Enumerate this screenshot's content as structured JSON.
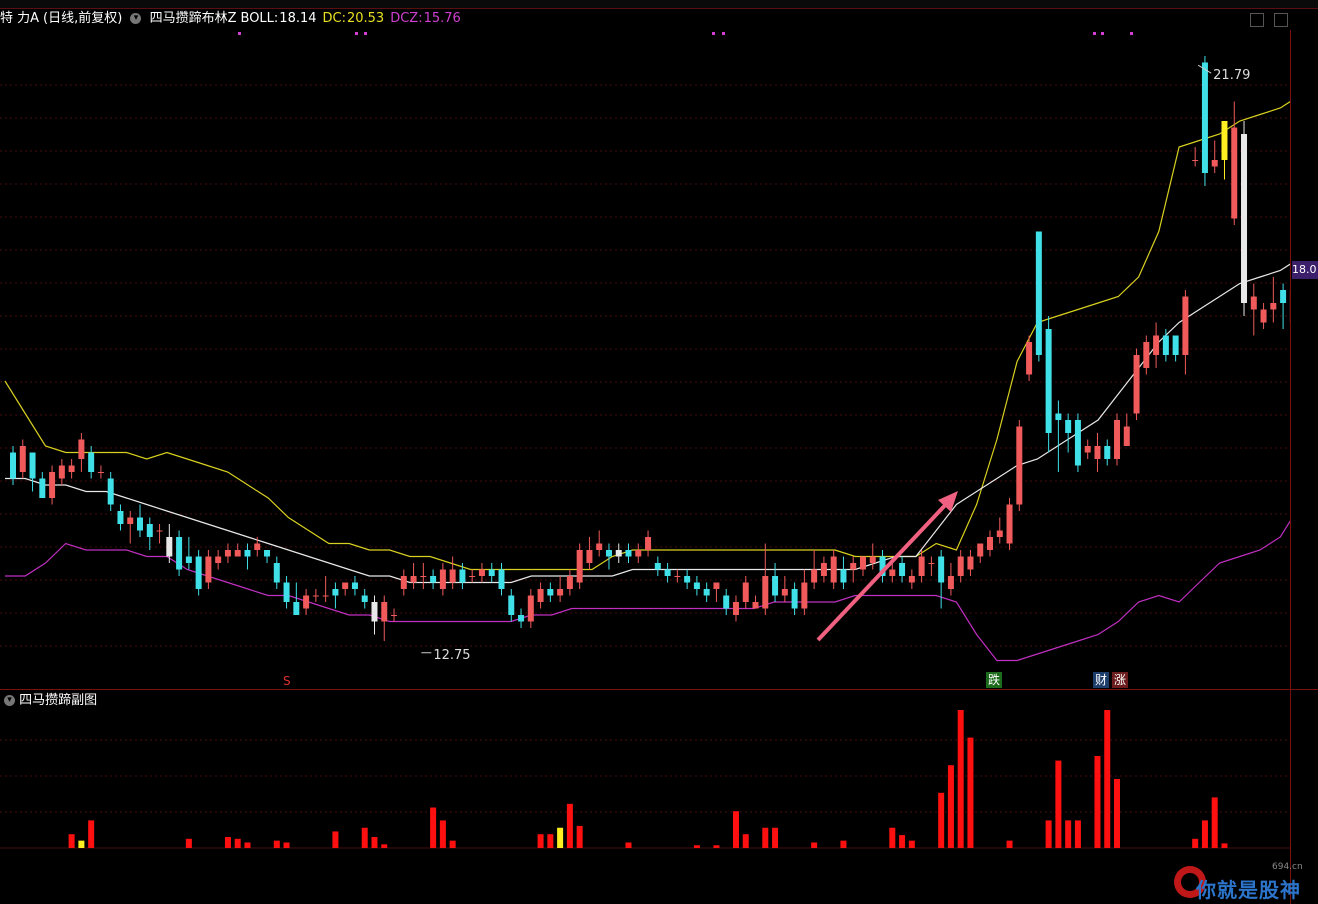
{
  "header": {
    "stock_name": "特 力A",
    "period": "(日线,前复权)",
    "indicator_name": "四马攒蹄布林Z",
    "boll_label": "BOLL:",
    "boll_value": "18.14",
    "dc_label": "DC:",
    "dc_value": "20.53",
    "dcz_label": "DCZ:",
    "dcz_value": "15.76"
  },
  "current_price_tag": "18.0",
  "subchart": {
    "title": "四马攒蹄副图"
  },
  "tags": {
    "s_marker": "S",
    "die": "跌",
    "cai": "财",
    "zhang": "涨"
  },
  "watermark": {
    "site": "694.cn",
    "text": "你就是股神"
  },
  "colors": {
    "up": "#f05a5a",
    "down": "#3fe0e8",
    "mid": "#e8e8e8",
    "upper": "#d8d020",
    "lower": "#c030c0",
    "bar": "#ff1010",
    "hl": "#ffee22",
    "arrow": "#f06080"
  },
  "chart_data": {
    "type": "candlestick",
    "price_range": [
      12.3,
      22.3
    ],
    "annotations": [
      {
        "text": "21.79",
        "kind": "high"
      },
      {
        "text": "12.75",
        "kind": "low"
      }
    ],
    "candles": [
      [
        15.8,
        15.4,
        15.9,
        15.3
      ],
      [
        15.5,
        15.9,
        16.0,
        15.4
      ],
      [
        15.8,
        15.4,
        15.8,
        15.2
      ],
      [
        15.4,
        15.1,
        15.5,
        15.1
      ],
      [
        15.1,
        15.5,
        15.6,
        15.0
      ],
      [
        15.4,
        15.6,
        15.7,
        15.3
      ],
      [
        15.5,
        15.6,
        15.7,
        15.4
      ],
      [
        15.7,
        16.0,
        16.1,
        15.5
      ],
      [
        15.8,
        15.5,
        15.9,
        15.4
      ],
      [
        15.5,
        15.5,
        15.6,
        15.4
      ],
      [
        15.4,
        15.0,
        15.5,
        14.9
      ],
      [
        14.9,
        14.7,
        15.0,
        14.6
      ],
      [
        14.7,
        14.8,
        14.9,
        14.4
      ],
      [
        14.8,
        14.6,
        15.0,
        14.5
      ],
      [
        14.7,
        14.5,
        14.8,
        14.3
      ],
      [
        14.6,
        14.6,
        14.7,
        14.4
      ],
      [
        14.5,
        14.2,
        14.7,
        14.1
      ],
      [
        14.5,
        14.0,
        14.6,
        13.9
      ],
      [
        14.2,
        14.1,
        14.5,
        14.0
      ],
      [
        14.2,
        13.7,
        14.3,
        13.6
      ],
      [
        13.8,
        14.2,
        14.3,
        13.7
      ],
      [
        14.1,
        14.2,
        14.3,
        14.0
      ],
      [
        14.2,
        14.3,
        14.4,
        14.1
      ],
      [
        14.2,
        14.3,
        14.4,
        14.2
      ],
      [
        14.3,
        14.2,
        14.4,
        14.0
      ],
      [
        14.3,
        14.4,
        14.5,
        14.2
      ],
      [
        14.3,
        14.2,
        14.3,
        14.1
      ],
      [
        14.1,
        13.8,
        14.2,
        13.7
      ],
      [
        13.8,
        13.5,
        13.9,
        13.4
      ],
      [
        13.5,
        13.3,
        13.8,
        13.3
      ],
      [
        13.4,
        13.6,
        13.7,
        13.3
      ],
      [
        13.6,
        13.6,
        13.7,
        13.5
      ],
      [
        13.6,
        13.6,
        13.9,
        13.5
      ],
      [
        13.7,
        13.6,
        13.8,
        13.4
      ],
      [
        13.7,
        13.8,
        13.8,
        13.6
      ],
      [
        13.8,
        13.7,
        13.9,
        13.6
      ],
      [
        13.6,
        13.5,
        13.7,
        13.4
      ],
      [
        13.5,
        13.2,
        13.6,
        13.0
      ],
      [
        13.2,
        13.5,
        13.6,
        12.9
      ],
      [
        13.3,
        13.3,
        13.4,
        13.2
      ],
      [
        13.7,
        13.9,
        14.0,
        13.6
      ],
      [
        13.8,
        13.9,
        14.1,
        13.7
      ],
      [
        13.9,
        13.9,
        14.1,
        13.7
      ],
      [
        13.9,
        13.8,
        14.0,
        13.7
      ],
      [
        13.7,
        14.0,
        14.1,
        13.6
      ],
      [
        13.8,
        14.0,
        14.2,
        13.7
      ],
      [
        14.0,
        13.8,
        14.1,
        13.7
      ],
      [
        13.9,
        13.9,
        14.0,
        13.8
      ],
      [
        13.9,
        14.0,
        14.1,
        13.8
      ],
      [
        14.0,
        13.9,
        14.1,
        13.8
      ],
      [
        14.0,
        13.7,
        14.1,
        13.6
      ],
      [
        13.6,
        13.3,
        13.7,
        13.2
      ],
      [
        13.3,
        13.2,
        13.4,
        13.1
      ],
      [
        13.2,
        13.6,
        13.7,
        13.1
      ],
      [
        13.5,
        13.7,
        13.8,
        13.4
      ],
      [
        13.7,
        13.6,
        13.8,
        13.5
      ],
      [
        13.6,
        13.7,
        13.9,
        13.5
      ],
      [
        13.7,
        13.9,
        14.0,
        13.6
      ],
      [
        13.8,
        14.3,
        14.4,
        13.7
      ],
      [
        14.1,
        14.3,
        14.5,
        14.0
      ],
      [
        14.3,
        14.4,
        14.6,
        14.2
      ],
      [
        14.3,
        14.2,
        14.4,
        14.0
      ],
      [
        14.2,
        14.3,
        14.4,
        14.1
      ],
      [
        14.3,
        14.2,
        14.4,
        14.1
      ],
      [
        14.2,
        14.3,
        14.4,
        14.1
      ],
      [
        14.3,
        14.5,
        14.6,
        14.2
      ],
      [
        14.1,
        14.0,
        14.2,
        13.9
      ],
      [
        14.0,
        13.9,
        14.1,
        13.8
      ],
      [
        13.9,
        13.9,
        14.0,
        13.8
      ],
      [
        13.9,
        13.8,
        14.0,
        13.7
      ],
      [
        13.8,
        13.7,
        13.9,
        13.6
      ],
      [
        13.7,
        13.6,
        13.8,
        13.5
      ],
      [
        13.7,
        13.8,
        13.8,
        13.5
      ],
      [
        13.6,
        13.4,
        13.7,
        13.3
      ],
      [
        13.3,
        13.5,
        13.6,
        13.2
      ],
      [
        13.5,
        13.8,
        13.9,
        13.4
      ],
      [
        13.4,
        13.5,
        13.6,
        13.4
      ],
      [
        13.4,
        13.9,
        14.4,
        13.3
      ],
      [
        13.9,
        13.6,
        14.1,
        13.5
      ],
      [
        13.6,
        13.7,
        13.9,
        13.5
      ],
      [
        13.7,
        13.4,
        13.8,
        13.3
      ],
      [
        13.4,
        13.8,
        14.0,
        13.3
      ],
      [
        13.8,
        14.0,
        14.3,
        13.7
      ],
      [
        13.9,
        14.1,
        14.2,
        13.8
      ],
      [
        13.8,
        14.2,
        14.3,
        13.7
      ],
      [
        14.0,
        13.8,
        14.2,
        13.7
      ],
      [
        14.0,
        14.1,
        14.2,
        13.8
      ],
      [
        14.0,
        14.2,
        14.2,
        13.9
      ],
      [
        14.1,
        14.2,
        14.4,
        14.0
      ],
      [
        14.2,
        13.9,
        14.3,
        13.8
      ],
      [
        13.9,
        14.0,
        14.1,
        13.8
      ],
      [
        14.1,
        13.9,
        14.2,
        13.8
      ],
      [
        13.8,
        13.9,
        14.0,
        13.7
      ],
      [
        13.9,
        14.2,
        14.3,
        13.8
      ],
      [
        14.1,
        14.1,
        14.2,
        13.9
      ],
      [
        14.2,
        13.8,
        14.3,
        13.4
      ],
      [
        13.7,
        13.9,
        14.1,
        13.6
      ],
      [
        13.9,
        14.2,
        14.3,
        13.8
      ],
      [
        14.0,
        14.2,
        14.3,
        13.9
      ],
      [
        14.2,
        14.4,
        14.4,
        14.1
      ],
      [
        14.3,
        14.5,
        14.6,
        14.2
      ],
      [
        14.5,
        14.6,
        14.8,
        14.4
      ],
      [
        14.4,
        15.0,
        15.1,
        14.3
      ],
      [
        15.0,
        16.2,
        16.3,
        14.9
      ],
      [
        17.0,
        17.5,
        17.6,
        16.9
      ],
      [
        19.2,
        17.3,
        19.2,
        17.2
      ],
      [
        17.7,
        16.1,
        17.9,
        15.8
      ],
      [
        16.4,
        16.3,
        16.6,
        15.5
      ],
      [
        16.3,
        16.1,
        16.4,
        15.8
      ],
      [
        16.3,
        15.6,
        16.4,
        15.5
      ],
      [
        15.8,
        15.9,
        16.0,
        15.7
      ],
      [
        15.7,
        15.9,
        16.1,
        15.5
      ],
      [
        15.9,
        15.7,
        16.0,
        15.6
      ],
      [
        15.7,
        16.3,
        16.4,
        15.6
      ],
      [
        15.9,
        16.2,
        16.4,
        15.9
      ],
      [
        16.4,
        17.3,
        17.4,
        16.3
      ],
      [
        17.1,
        17.5,
        17.6,
        17.0
      ],
      [
        17.3,
        17.6,
        17.8,
        17.1
      ],
      [
        17.6,
        17.3,
        17.7,
        17.2
      ],
      [
        17.6,
        17.3,
        17.6,
        17.2
      ],
      [
        17.3,
        18.2,
        18.3,
        17.0
      ],
      [
        20.3,
        20.3,
        20.5,
        20.2
      ],
      [
        21.8,
        20.1,
        21.9,
        19.9
      ],
      [
        20.2,
        20.3,
        20.6,
        20.1
      ],
      [
        20.3,
        20.9,
        20.9,
        20.0
      ],
      [
        19.4,
        20.8,
        21.2,
        19.3
      ],
      [
        20.7,
        18.1,
        20.9,
        17.9
      ],
      [
        18.0,
        18.2,
        18.4,
        17.6
      ],
      [
        17.8,
        18.0,
        18.1,
        17.7
      ],
      [
        18.0,
        18.1,
        18.5,
        17.8
      ],
      [
        18.3,
        18.1,
        18.4,
        17.7
      ],
      [
        17.8,
        18.3,
        18.8,
        17.7
      ],
      [
        18.5,
        18.2,
        18.6,
        18.0
      ],
      [
        18.0,
        18.5,
        18.6,
        17.9
      ],
      [
        19.0,
        19.3,
        19.6,
        18.6
      ],
      [
        19.3,
        19.0,
        19.6,
        18.9
      ],
      [
        19.2,
        18.5,
        19.5,
        18.4
      ],
      [
        18.8,
        18.0,
        18.9,
        17.9
      ],
      [
        18.2,
        17.3,
        18.2,
        17.3
      ]
    ],
    "candle_colors": {
      "16": "#e8e8e8",
      "37": "#e8e8e8",
      "62": "#e8e8e8",
      "126": "#e8e8e8",
      "124": "#ffee22"
    },
    "series": [
      {
        "line": "upper",
        "values": [
          16.9,
          16.4,
          15.9,
          15.8,
          15.8,
          15.8,
          15.8,
          15.7,
          15.8,
          15.7,
          15.6,
          15.5,
          15.3,
          15.1,
          14.8,
          14.6,
          14.4,
          14.4,
          14.3,
          14.3,
          14.2,
          14.2,
          14.1,
          14.0,
          14.0,
          14.0,
          14.0,
          14.0,
          14.0,
          14.0,
          14.2,
          14.3,
          14.3,
          14.3,
          14.3,
          14.3,
          14.3,
          14.3,
          14.3,
          14.3,
          14.3,
          14.3,
          14.2,
          14.2,
          14.2,
          14.2,
          14.4,
          14.3,
          15.0,
          16.0,
          17.2,
          17.8,
          17.9,
          18.0,
          18.1,
          18.2,
          18.5,
          19.2,
          20.5,
          20.6,
          20.7,
          20.9,
          21.0,
          21.1,
          21.3,
          21.4,
          21.3,
          21.1
        ]
      },
      {
        "line": "mid",
        "values": [
          15.4,
          15.4,
          15.3,
          15.3,
          15.2,
          15.2,
          15.1,
          15.0,
          14.9,
          14.8,
          14.7,
          14.6,
          14.5,
          14.4,
          14.3,
          14.2,
          14.1,
          14.0,
          13.9,
          13.9,
          13.8,
          13.8,
          13.8,
          13.8,
          13.8,
          13.8,
          13.9,
          13.9,
          13.9,
          13.9,
          13.9,
          14.0,
          14.0,
          14.0,
          14.0,
          14.0,
          14.0,
          14.0,
          14.0,
          14.0,
          14.0,
          14.0,
          14.0,
          14.1,
          14.2,
          14.2,
          14.6,
          15.0,
          15.2,
          15.4,
          15.6,
          15.7,
          15.9,
          16.1,
          16.3,
          16.7,
          17.1,
          17.5,
          17.8,
          18.0,
          18.2,
          18.4,
          18.5,
          18.6,
          18.8,
          19.0,
          19.1,
          19.3
        ]
      },
      {
        "line": "lower",
        "values": [
          13.9,
          13.9,
          14.1,
          14.4,
          14.3,
          14.3,
          14.3,
          14.2,
          14.2,
          14.0,
          13.9,
          13.8,
          13.7,
          13.6,
          13.6,
          13.5,
          13.4,
          13.3,
          13.3,
          13.2,
          13.2,
          13.2,
          13.2,
          13.2,
          13.2,
          13.2,
          13.3,
          13.3,
          13.4,
          13.4,
          13.4,
          13.4,
          13.4,
          13.4,
          13.4,
          13.4,
          13.4,
          13.4,
          13.5,
          13.5,
          13.5,
          13.5,
          13.6,
          13.6,
          13.6,
          13.6,
          13.6,
          13.5,
          13.0,
          12.6,
          12.6,
          12.7,
          12.8,
          12.9,
          13.0,
          13.2,
          13.5,
          13.6,
          13.5,
          13.8,
          14.1,
          14.2,
          14.3,
          14.5,
          15.0,
          15.8,
          16.5,
          17.3
        ]
      }
    ],
    "sub_bars": [
      [
        6,
        15,
        "#ff1010"
      ],
      [
        7,
        8,
        "#ffee22"
      ],
      [
        8,
        30,
        "#ff1010"
      ],
      [
        18,
        10,
        "#ff1010"
      ],
      [
        22,
        12,
        "#ff1010"
      ],
      [
        23,
        10,
        "#ff1010"
      ],
      [
        24,
        6,
        "#ff1010"
      ],
      [
        27,
        8,
        "#ff1010"
      ],
      [
        28,
        6,
        "#ff1010"
      ],
      [
        33,
        18,
        "#ff1010"
      ],
      [
        36,
        22,
        "#ff1010"
      ],
      [
        37,
        12,
        "#ff1010"
      ],
      [
        38,
        4,
        "#ff1010"
      ],
      [
        43,
        44,
        "#ff1010"
      ],
      [
        44,
        30,
        "#ff1010"
      ],
      [
        45,
        8,
        "#ff1010"
      ],
      [
        54,
        15,
        "#ff1010"
      ],
      [
        55,
        15,
        "#ff1010"
      ],
      [
        56,
        22,
        "#ffee22"
      ],
      [
        57,
        48,
        "#ff1010"
      ],
      [
        58,
        24,
        "#ff1010"
      ],
      [
        63,
        6,
        "#ff1010"
      ],
      [
        70,
        3,
        "#ff1010"
      ],
      [
        72,
        3,
        "#ff1010"
      ],
      [
        74,
        40,
        "#ff1010"
      ],
      [
        75,
        15,
        "#ff1010"
      ],
      [
        77,
        22,
        "#ff1010"
      ],
      [
        78,
        22,
        "#ff1010"
      ],
      [
        82,
        6,
        "#ff1010"
      ],
      [
        85,
        8,
        "#ff1010"
      ],
      [
        90,
        22,
        "#ff1010"
      ],
      [
        91,
        14,
        "#ff1010"
      ],
      [
        92,
        8,
        "#ff1010"
      ],
      [
        95,
        60,
        "#ff1010"
      ],
      [
        96,
        90,
        "#ff1010"
      ],
      [
        97,
        150,
        "#ff1010"
      ],
      [
        98,
        120,
        "#ff1010"
      ],
      [
        102,
        8,
        "#ff1010"
      ],
      [
        106,
        30,
        "#ff1010"
      ],
      [
        107,
        95,
        "#ff1010"
      ],
      [
        108,
        30,
        "#ff1010"
      ],
      [
        109,
        30,
        "#ff1010"
      ],
      [
        111,
        100,
        "#ff1010"
      ],
      [
        112,
        150,
        "#ff1010"
      ],
      [
        113,
        75,
        "#ff1010"
      ],
      [
        121,
        10,
        "#ff1010"
      ],
      [
        122,
        30,
        "#ff1010"
      ],
      [
        123,
        55,
        "#ff1010"
      ],
      [
        124,
        5,
        "#ff1010"
      ]
    ]
  }
}
